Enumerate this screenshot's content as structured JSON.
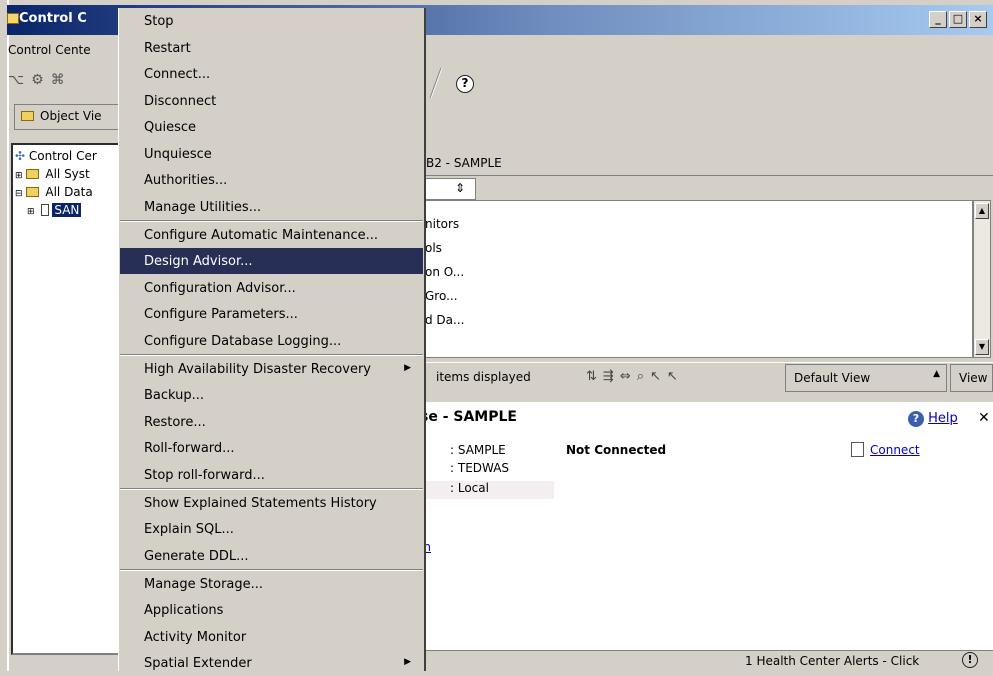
{
  "window": {
    "title": "Control C",
    "minimize": "_",
    "maximize": "□",
    "close": "×"
  },
  "menubar": {
    "label": "Control Cente"
  },
  "toolbar": {
    "help_icon": "?"
  },
  "object_view_button": "Object Vie",
  "tree": {
    "root": "Control Cer",
    "items": [
      "All Syst",
      "All Data",
      "SAN"
    ]
  },
  "right_panel": {
    "header": "B2 - SAMPLE",
    "combo_glyph": "⇕",
    "list_items": [
      "nitors",
      "ols",
      "on O...",
      "Gro...",
      "d Da..."
    ],
    "status": "items displayed",
    "view_combo": "Default View",
    "view_button": "View"
  },
  "detail": {
    "title": "se - SAMPLE",
    "help": "Help",
    "props": [
      ": SAMPLE",
      ": TEDWAS",
      ": Local"
    ],
    "connection_status": "Not Connected",
    "connect_link": "Connect",
    "bottom_link": "in"
  },
  "bottom_status": {
    "alerts": "1 Health Center Alerts - Click",
    "alert_icon": "!"
  },
  "context_menu": {
    "items": [
      {
        "label": "Stop"
      },
      {
        "label": "Restart"
      },
      {
        "label": "Connect..."
      },
      {
        "label": "Disconnect"
      },
      {
        "label": "Quiesce"
      },
      {
        "label": "Unquiesce"
      },
      {
        "label": "Authorities..."
      },
      {
        "label": "Manage Utilities..."
      },
      {
        "label": "Configure Automatic Maintenance..."
      },
      {
        "label": "Design Advisor...",
        "selected": true
      },
      {
        "label": "Configuration Advisor..."
      },
      {
        "label": "Configure Parameters..."
      },
      {
        "label": "Configure Database Logging..."
      },
      {
        "label": "High Availability Disaster Recovery",
        "submenu": true
      },
      {
        "label": "Backup..."
      },
      {
        "label": "Restore..."
      },
      {
        "label": "Roll-forward..."
      },
      {
        "label": "Stop roll-forward..."
      },
      {
        "label": "Show Explained Statements History"
      },
      {
        "label": "Explain SQL..."
      },
      {
        "label": "Generate DDL..."
      },
      {
        "label": "Manage Storage..."
      },
      {
        "label": "Applications"
      },
      {
        "label": "Activity Monitor"
      },
      {
        "label": "Spatial Extender",
        "submenu": true
      }
    ],
    "submenu_arrow": "▶"
  }
}
